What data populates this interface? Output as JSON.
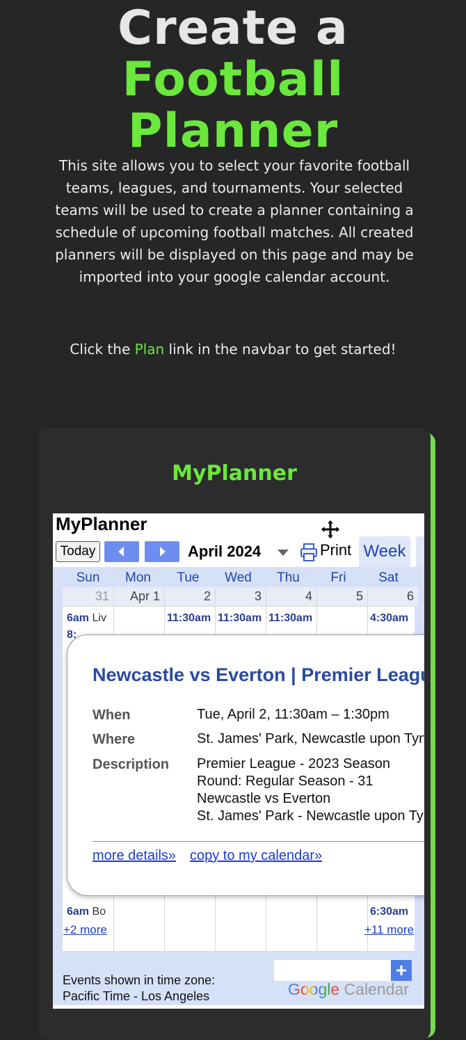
{
  "hero": {
    "title_part1": "Create a",
    "title_part2": "Football",
    "title_line2": "Planner"
  },
  "intro": "This site allows you to select your favorite football teams, leagues, and tournaments. Your selected teams will be used to create a planner containing a schedule of upcoming football matches. All created planners will be displayed on this page and may be imported into your google calendar account.",
  "cta": {
    "before": "Click the",
    "link": "Plan",
    "after": "link in the navbar to get started!"
  },
  "planner_card": {
    "title": "MyPlanner"
  },
  "calendar": {
    "title": "MyPlanner",
    "today_label": "Today",
    "month": "April 2024",
    "print_label": "Print",
    "view_tab": "Week",
    "weekdays": [
      "Sun",
      "Mon",
      "Tue",
      "Wed",
      "Thu",
      "Fri",
      "Sat"
    ],
    "dates": [
      "31",
      "Apr 1",
      "2",
      "3",
      "4",
      "5",
      "6"
    ],
    "row1_events": {
      "sun_time": "6am",
      "sun_name": "Liv",
      "sun_line2": "8:",
      "tue": "11:30am",
      "wed": "11:30am",
      "thu": "11:30am",
      "sat": "4:30am"
    },
    "bottom_events": {
      "sun_time": "6am",
      "sun_name": "Bo",
      "sun_more": "+2 more",
      "sat_time": "6:30am",
      "sat_more": "+11 more"
    },
    "timezone_line1": "Events shown in time zone:",
    "timezone_line2": "Pacific Time - Los Angeles",
    "brand_google": "Google",
    "brand_calendar": "Calendar",
    "add_label": "+"
  },
  "event_popup": {
    "title": "Newcastle vs Everton | Premier League",
    "when_label": "When",
    "when_value": "Tue, April 2, 11:30am – 1:30pm",
    "where_label": "Where",
    "where_value": "St. James' Park, Newcastle upon Tyne",
    "description_label": "Description",
    "description_lines": [
      "Premier League - 2023 Season",
      "Round: Regular Season - 31",
      "Newcastle vs Everton",
      "St. James' Park - Newcastle upon Tyne"
    ],
    "more_details": "more details»",
    "copy_to_calendar": "copy to my calendar»"
  }
}
